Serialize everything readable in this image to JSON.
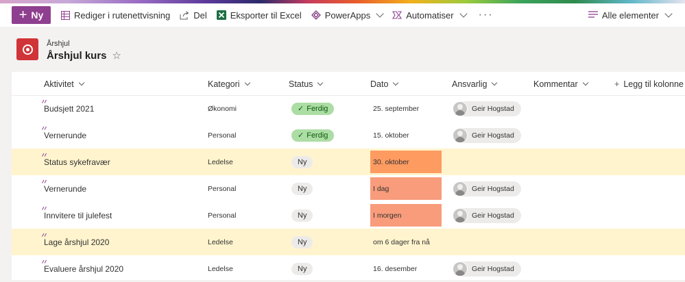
{
  "command_bar": {
    "new_label": "Ny",
    "grid_view_label": "Rediger i rutenettvisning",
    "share_label": "Del",
    "export_label": "Eksporter til Excel",
    "powerapps_label": "PowerApps",
    "automate_label": "Automatiser",
    "more_label": "···",
    "view_label": "Alle elementer"
  },
  "header": {
    "breadcrumb": "Årshjul",
    "title": "Årshjul kurs"
  },
  "columns": {
    "activity": "Aktivitet",
    "category": "Kategori",
    "status": "Status",
    "date": "Dato",
    "responsible": "Ansvarlig",
    "comment": "Kommentar",
    "add_column": "Legg til kolonne"
  },
  "rows": [
    {
      "activity": "Budsjett 2021",
      "category": "Økonomi",
      "status": "Ferdig",
      "date": "25. september",
      "responsible": "Geir Hogstad"
    },
    {
      "activity": "Vernerunde",
      "category": "Personal",
      "status": "Ferdig",
      "date": "15. oktober",
      "responsible": "Geir Hogstad"
    },
    {
      "activity": "Status sykefravær",
      "category": "Ledelse",
      "status": "Ny",
      "date": "30. oktober",
      "responsible": ""
    },
    {
      "activity": "Vernerunde",
      "category": "Personal",
      "status": "Ny",
      "date": "I dag",
      "responsible": "Geir Hogstad"
    },
    {
      "activity": "Innvitere til julefest",
      "category": "Personal",
      "status": "Ny",
      "date": "I morgen",
      "responsible": "Geir Hogstad"
    },
    {
      "activity": "Lage årshjul 2020",
      "category": "Ledelse",
      "status": "Ny",
      "date": "om 6 dager fra nå",
      "responsible": ""
    },
    {
      "activity": "Evaluere årshjul 2020",
      "category": "Ledelse",
      "status": "Ny",
      "date": "16. desember",
      "responsible": "Geir Hogstad"
    }
  ],
  "colors": {
    "accent": "#8f3f8f",
    "highlight_row": "#fff4ce",
    "date_orange": "#fe9b61",
    "date_salmon": "#f89c7c",
    "status_done": "#acdda4"
  }
}
